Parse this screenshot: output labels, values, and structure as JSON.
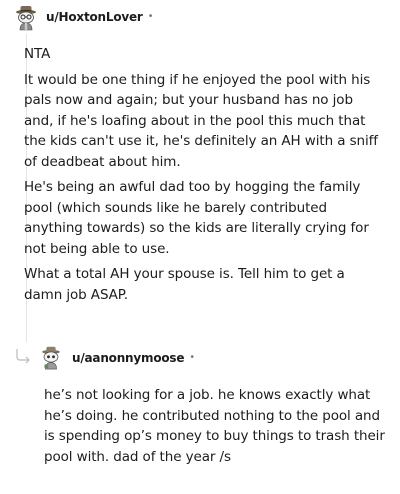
{
  "comments": [
    {
      "username": "u/HoxtonLover",
      "separator": "•",
      "avatar_icon": "snoo-avatar-icon",
      "paragraphs": [
        "NTA",
        "It would be one thing if he enjoyed the pool with his pals now and again; but your husband has no job and, if he's loafing about in the pool this much that the kids can't use it, he's definitely an AH with a sniff of deadbeat about him.",
        "He's being an awful dad too by hogging the family pool (which sounds like he barely contributed anything towards) so the kids are literally crying for not being able to use.",
        "What a total AH your spouse is. Tell him to get a damn job ASAP."
      ]
    },
    {
      "username": "u/aanonnymoose",
      "separator": "•",
      "avatar_icon": "snoo-avatar-icon",
      "reply_icon": "reply-arrow-icon",
      "paragraphs": [
        "he’s not looking for a job. he knows exactly what he’s doing. he contributed nothing to the pool and is spending op’s money to buy things to trash their pool with. dad of the year /s"
      ]
    }
  ],
  "colors": {
    "text": "#1c1c1c",
    "muted": "#7c7c7c",
    "thread_line": "#e2e5e8"
  }
}
